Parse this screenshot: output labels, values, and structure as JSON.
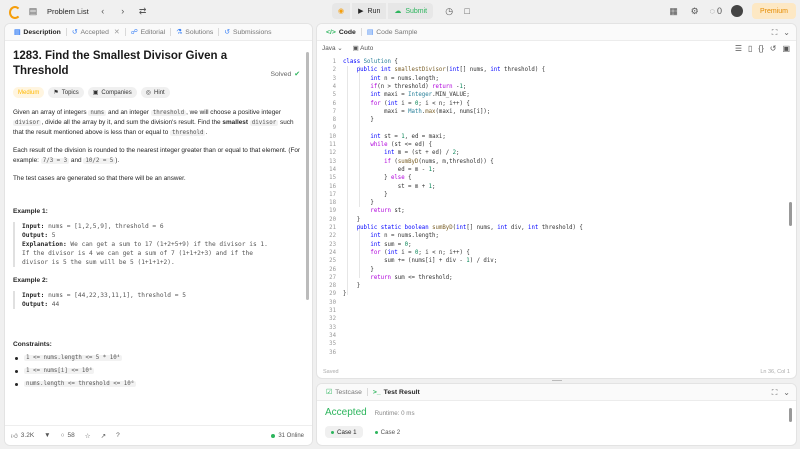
{
  "topbar": {
    "problem_list_label": "Problem List",
    "run_label": "Run",
    "submit_label": "Submit",
    "fire_count": "0",
    "premium_label": "Premium",
    "accent_color": "#f59e0b",
    "submit_color": "#2db55d"
  },
  "left_tabs": [
    {
      "label": "Description",
      "icon": "description-icon",
      "active": true
    },
    {
      "label": "Accepted",
      "icon": "history-icon",
      "active": false
    },
    {
      "label": "Editorial",
      "icon": "editorial-icon",
      "active": false
    },
    {
      "label": "Solutions",
      "icon": "flask-icon",
      "active": false
    },
    {
      "label": "Submissions",
      "icon": "history-icon",
      "active": false
    }
  ],
  "problem": {
    "title": "1283. Find the Smallest Divisor Given a Threshold",
    "status": "Solved",
    "difficulty": "Medium",
    "chips": [
      "Topics",
      "Companies",
      "Hint"
    ],
    "p1_a": "Given an array of integers ",
    "p1_nums": "nums",
    "p1_b": " and an integer ",
    "p1_threshold": "threshold",
    "p1_c": ", we will choose a positive integer ",
    "p1_divisor": "divisor",
    "p1_d": ", divide all the array by it, and sum the division's result. Find the ",
    "p1_smallest": "smallest",
    "p1_divisor2": "divisor",
    "p1_e": " such that the result mentioned above is less than or equal to ",
    "p1_threshold2": "threshold",
    "p1_end": ".",
    "p2_a": "Each result of the division is rounded to the nearest integer greater than or equal to that element. (For example: ",
    "p2_code1": "7/3 = 3",
    "p2_b": " and ",
    "p2_code2": "10/2 = 5",
    "p2_c": ").",
    "p3": "The test cases are generated so that there will be an answer.",
    "example1_title": "Example 1:",
    "example1_input_label": "Input:",
    "example1_input": " nums = [1,2,5,9], threshold = 6",
    "example1_output_label": "Output:",
    "example1_output": " 5",
    "example1_expl_label": "Explanation:",
    "example1_expl": " We can get a sum to 17 (1+2+5+9) if the divisor is 1.",
    "example1_expl2": "If the divisor is 4 we can get a sum of 7 (1+1+2+3) and if the",
    "example1_expl3": "divisor is 5 the sum will be 5 (1+1+1+2).",
    "example2_title": "Example 2:",
    "example2_input_label": "Input:",
    "example2_input": " nums = [44,22,33,11,1], threshold = 5",
    "example2_output_label": "Output:",
    "example2_output": " 44",
    "constraints_title": "Constraints:",
    "constraints": [
      "1 <= nums.length <= 5 * 10⁴",
      "1 <= nums[i] <= 10⁶",
      "nums.length <= threshold <= 10⁶"
    ]
  },
  "left_bottom": {
    "likes": "3.2K",
    "comments": "58",
    "online": "31 Online"
  },
  "code_tabs": [
    {
      "label": "Code",
      "active": true
    },
    {
      "label": "Code Sample",
      "active": false
    }
  ],
  "editor": {
    "language": "Java",
    "mode": "Auto",
    "status_left": "Saved",
    "status_right": "Ln 36, Col 1"
  },
  "code_lines": [
    "class Solution {",
    "    public int smallestDivisor(int[] nums, int threshold) {",
    "        int n = nums.length;",
    "        if(n > threshold) return -1;",
    "        int maxi = Integer.MIN_VALUE;",
    "        for (int i = 0; i < n; i++) {",
    "            maxi = Math.max(maxi, nums[i]);",
    "        }",
    "",
    "        int st = 1, ed = maxi;",
    "        while (st <= ed) {",
    "            int m = (st + ed) / 2;",
    "            if (sumByD(nums, m,threshold)) {",
    "                ed = m - 1;",
    "            } else {",
    "                st = m + 1;",
    "            }",
    "        }",
    "        return st;",
    "    }",
    "    public static boolean sumByD(int[] nums, int div, int threshold) {",
    "        int n = nums.length;",
    "        int sum = 0;",
    "        for (int i = 0; i < n; i++) {",
    "            sum += (nums[i] + div - 1) / div;",
    "        }",
    "        return sum <= threshold;",
    "    }",
    "}",
    "",
    "",
    "",
    "",
    "",
    "",
    ""
  ],
  "result_tabs": [
    {
      "label": "Testcase",
      "active": false
    },
    {
      "label": "Test Result",
      "active": true
    }
  ],
  "result": {
    "status": "Accepted",
    "runtime": "Runtime: 0 ms",
    "cases": [
      "Case 1",
      "Case 2"
    ]
  }
}
